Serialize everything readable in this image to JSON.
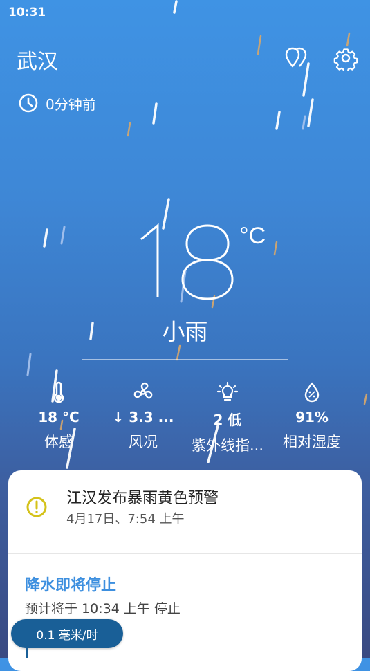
{
  "status_bar": {
    "time": "10:31"
  },
  "header": {
    "city": "武汉",
    "updated": "0分钟前",
    "icons": {
      "locations": "location-pins-icon",
      "settings": "gear-icon",
      "clock": "clock-icon"
    }
  },
  "current": {
    "temperature": "18",
    "unit": "°C",
    "condition": "小雨"
  },
  "metrics": [
    {
      "icon": "thermometer-icon",
      "value": "18 °C",
      "label": "体感"
    },
    {
      "icon": "wind-fan-icon",
      "value": "↓ 3.3 ...",
      "label": "风况"
    },
    {
      "icon": "lightbulb-icon",
      "value": "2 低",
      "label": "紫外线指..."
    },
    {
      "icon": "humidity-drop-icon",
      "value": "91%",
      "label": "相对湿度"
    }
  ],
  "alert": {
    "icon": "warning-circle-icon",
    "title": "江汉发布暴雨黄色预警",
    "time": "4月17日、7:54 上午"
  },
  "precipitation": {
    "title": "降水即将停止",
    "subtitle": "预计将于 10:34 上午 停止",
    "rate": "0.1 毫米/时"
  },
  "colors": {
    "accent": "#3d8fdf",
    "alert_yellow": "#d4c21a",
    "badge": "#195f97"
  }
}
